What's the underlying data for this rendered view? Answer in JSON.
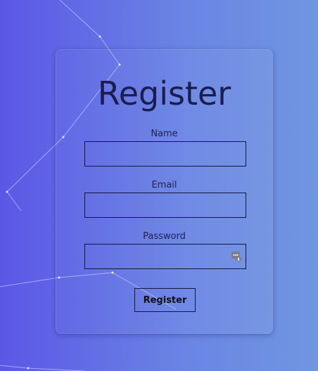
{
  "form": {
    "title": "Register",
    "fields": [
      {
        "label": "Name",
        "value": "",
        "type": "text"
      },
      {
        "label": "Email",
        "value": "",
        "type": "email"
      },
      {
        "label": "Password",
        "value": "",
        "type": "password"
      }
    ],
    "submit_label": "Register"
  },
  "icons": {
    "password_manager": "password-manager-icon"
  },
  "colors": {
    "background_start": "#5b57e6",
    "background_end": "#7096e0",
    "title": "#1b1d4d",
    "border": "#15163a"
  }
}
